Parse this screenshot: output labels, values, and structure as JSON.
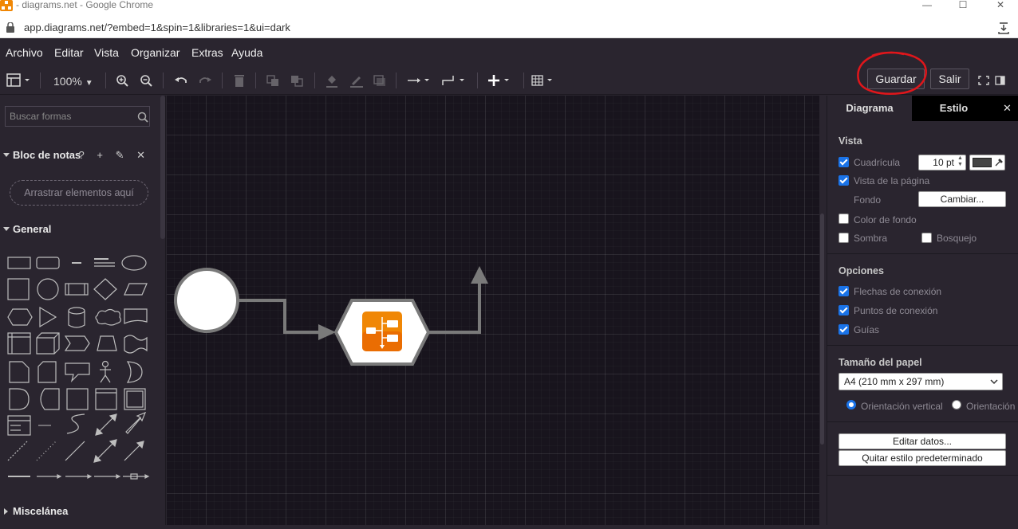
{
  "browser": {
    "title": "- diagrams.net - Google Chrome",
    "url": "app.diagrams.net/?embed=1&spin=1&libraries=1&ui=dark"
  },
  "menu": [
    "Archivo",
    "Editar",
    "Vista",
    "Organizar",
    "Extras",
    "Ayuda"
  ],
  "toolbar": {
    "zoom": "100%",
    "save": "Guardar",
    "exit": "Salir"
  },
  "left_panel": {
    "search_placeholder": "Buscar formas",
    "notes_title": "Bloc de notas",
    "notes_icons": "? + ✎ ✕",
    "drop_zone": "Arrastrar elementos aquí",
    "general_title": "General",
    "misc_title": "Miscelánea"
  },
  "right_panel": {
    "tab_diagram": "Diagrama",
    "tab_style": "Estilo",
    "close": "✕",
    "view_title": "Vista",
    "grid_label": "Cuadrícula",
    "grid_size": "10 pt",
    "page_view_label": "Vista de la página",
    "background_label": "Fondo",
    "change_button": "Cambiar...",
    "bg_color_label": "Color de fondo",
    "shadow_label": "Sombra",
    "sketch_label": "Bosquejo",
    "options_title": "Opciones",
    "conn_arrows_label": "Flechas de conexión",
    "conn_points_label": "Puntos de conexión",
    "guides_label": "Guías",
    "paper_title": "Tamaño del papel",
    "paper_size": "A4 (210 mm x 297 mm)",
    "orient_portrait": "Orientación vertical",
    "orient_landscape": "Orientación horizontal",
    "edit_data_button": "Editar datos...",
    "remove_style_button": "Quitar estilo predeterminado"
  },
  "colors": {
    "accent": "#1a73e8",
    "annotation_red": "#e0161b",
    "node_orange": "#f08705"
  }
}
